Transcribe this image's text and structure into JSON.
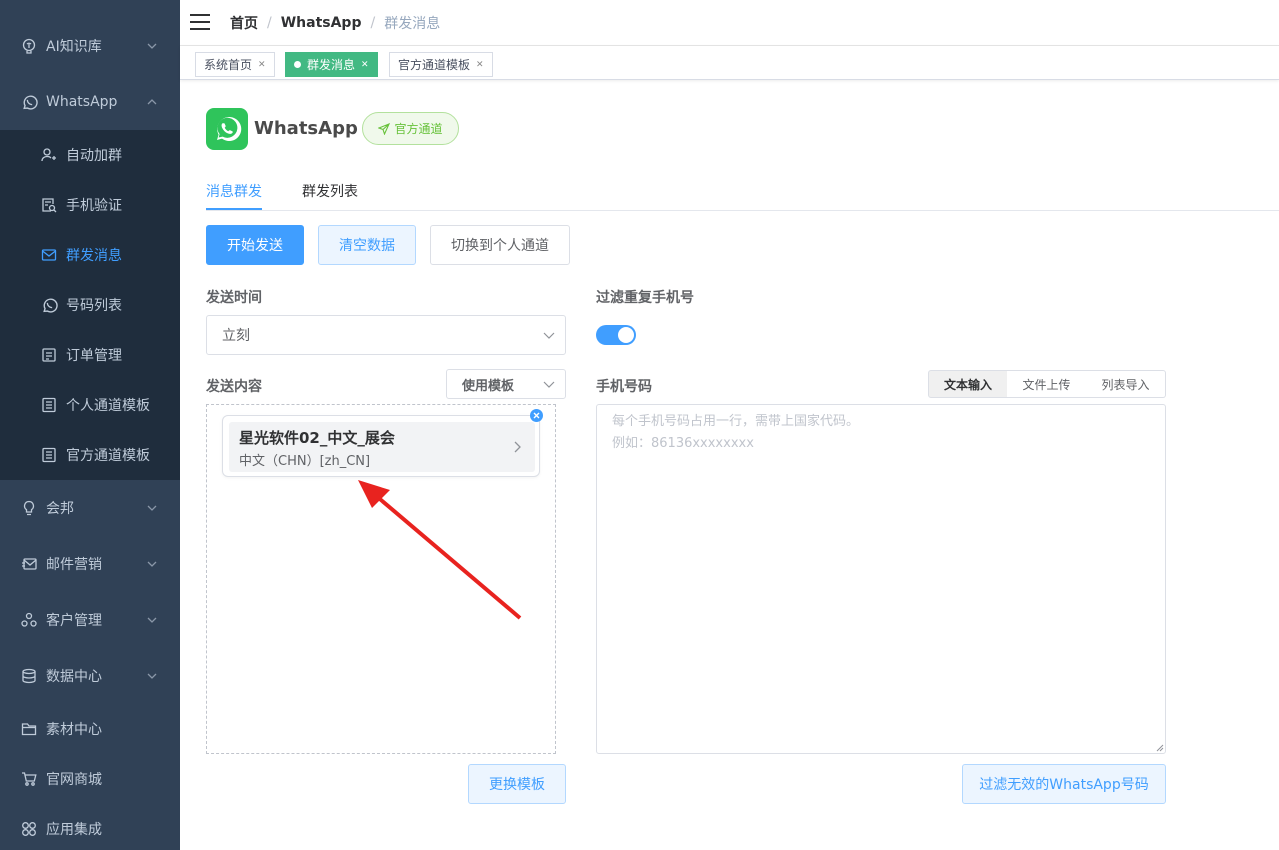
{
  "sidebar": {
    "items": [
      {
        "label": "AI知识库",
        "icon": "brain-icon"
      },
      {
        "label": "WhatsApp",
        "icon": "whatsapp-icon"
      },
      {
        "label": "会邦",
        "icon": "lightbulb-icon"
      },
      {
        "label": "邮件营销",
        "icon": "mail-icon"
      },
      {
        "label": "客户管理",
        "icon": "users-icon"
      },
      {
        "label": "数据中心",
        "icon": "database-icon"
      },
      {
        "label": "素材中心",
        "icon": "folder-icon"
      },
      {
        "label": "官网商城",
        "icon": "cart-icon"
      },
      {
        "label": "应用集成",
        "icon": "apps-icon"
      }
    ],
    "sub_items": [
      {
        "label": "自动加群",
        "icon": "user-add-icon"
      },
      {
        "label": "手机验证",
        "icon": "doc-search-icon"
      },
      {
        "label": "群发消息",
        "icon": "envelope-icon",
        "active": true
      },
      {
        "label": "号码列表",
        "icon": "whatsapp-icon"
      },
      {
        "label": "订单管理",
        "icon": "order-icon"
      },
      {
        "label": "个人通道模板",
        "icon": "template-icon"
      },
      {
        "label": "官方通道模板",
        "icon": "template-icon"
      }
    ]
  },
  "header": {
    "breadcrumb": [
      "首页",
      "WhatsApp",
      "群发消息"
    ],
    "separator": "/"
  },
  "tags": [
    {
      "label": "系统首页",
      "active": false
    },
    {
      "label": "群发消息",
      "active": true
    },
    {
      "label": "官方通道模板",
      "active": false
    }
  ],
  "page": {
    "brand_title": "WhatsApp",
    "official_label": "官方通道",
    "tabs": [
      "消息群发",
      "群发列表"
    ],
    "buttons": {
      "start": "开始发送",
      "clear": "清空数据",
      "switch": "切换到个人通道"
    },
    "send_time": {
      "label": "发送时间",
      "value": "立刻"
    },
    "filter_dup": {
      "label": "过滤重复手机号",
      "enabled": true
    },
    "content": {
      "label": "发送内容",
      "use_template": "使用模板",
      "template_name": "星光软件02_中文_展会",
      "template_lang": "中文（CHN）[zh_CN]",
      "change_button": "更换模板"
    },
    "phones": {
      "label": "手机号码",
      "modes": [
        "文本输入",
        "文件上传",
        "列表导入"
      ],
      "placeholder": "每个手机号码占用一行，需带上国家代码。\n例如：86136xxxxxxxx",
      "filter_button": "过滤无效的WhatsApp号码"
    }
  },
  "colors": {
    "sidebar_bg": "#304156",
    "sidebar_sub_bg": "#1f2d3d",
    "accent": "#409eff",
    "tag_active": "#42b983",
    "whatsapp_green": "#2fc45b",
    "annotation_arrow": "#e8231f"
  }
}
